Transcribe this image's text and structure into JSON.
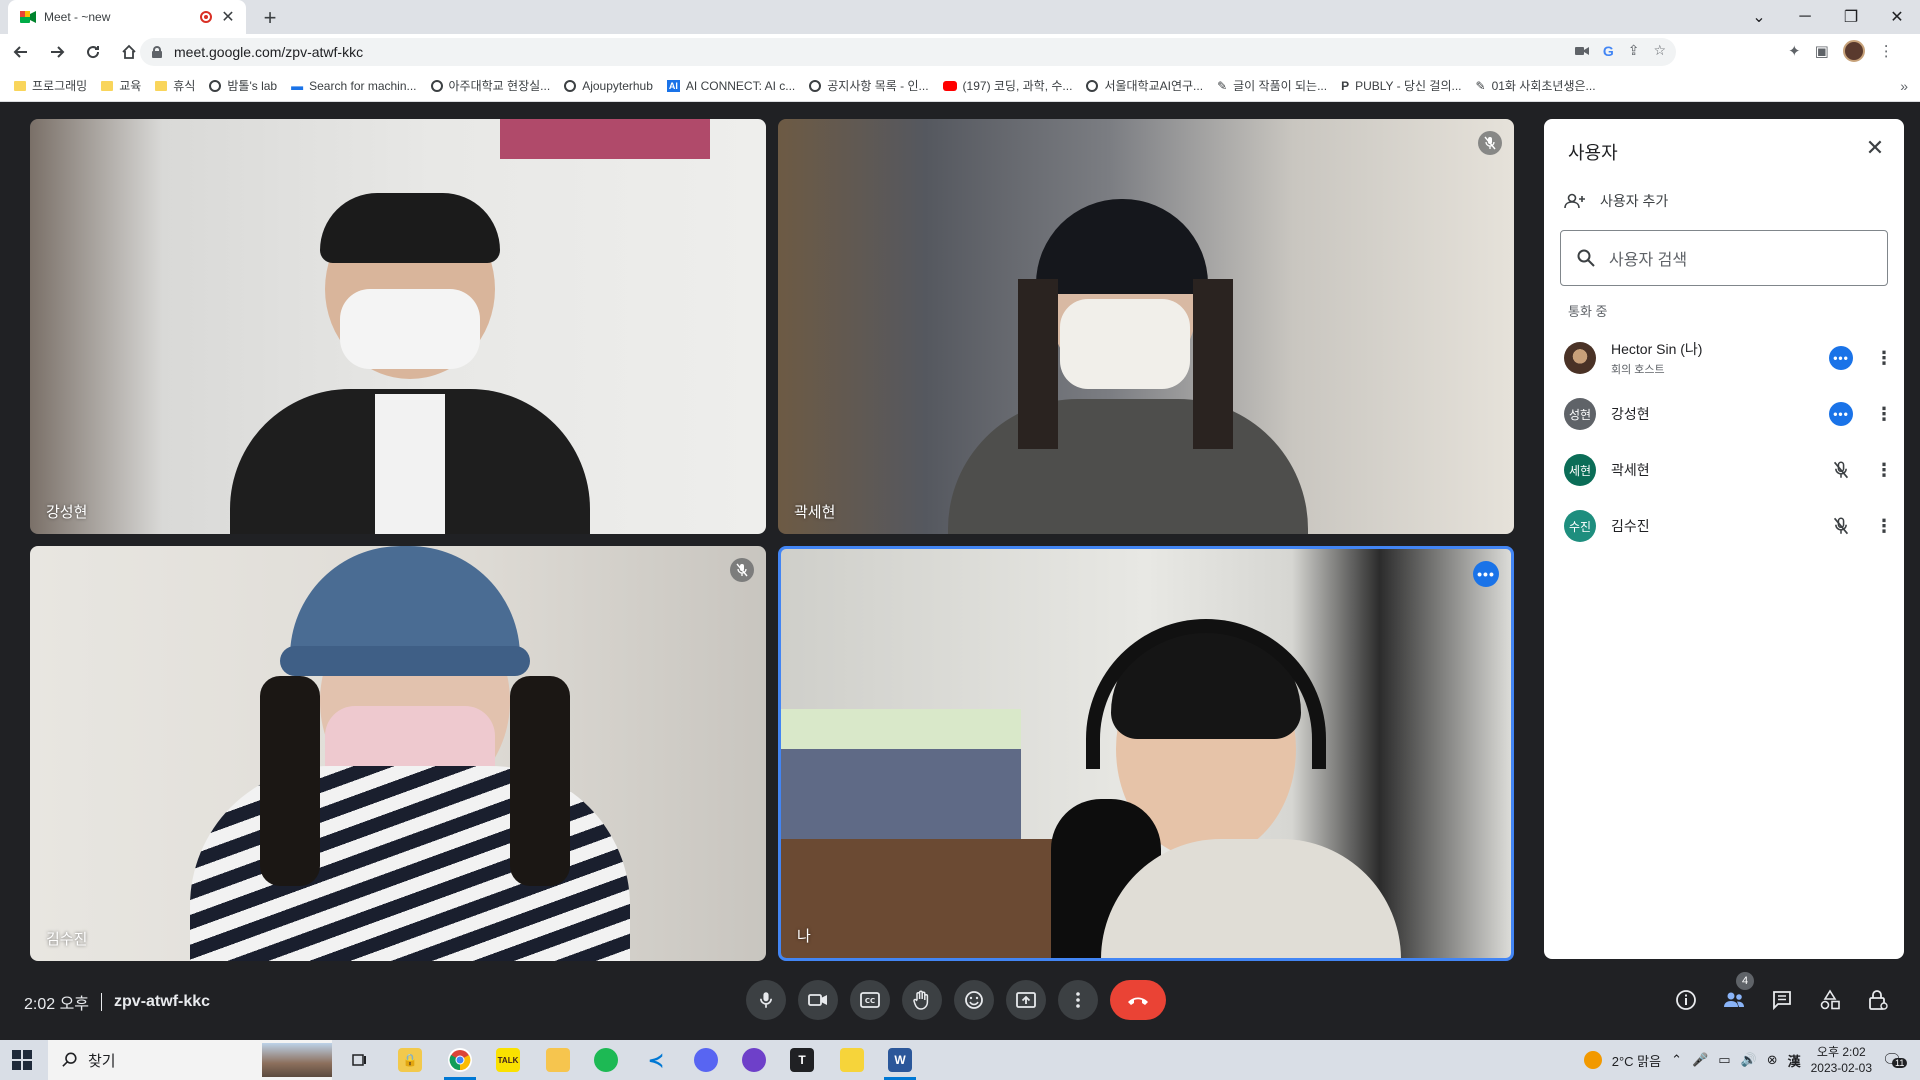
{
  "browser": {
    "tab_title": "Meet - ~new",
    "url": "meet.google.com/zpv-atwf-kkc",
    "bookmarks": [
      {
        "label": "프로그래밍",
        "icon": "folder-icon"
      },
      {
        "label": "교육",
        "icon": "folder-icon"
      },
      {
        "label": "휴식",
        "icon": "folder-icon"
      },
      {
        "label": "밤톨's lab",
        "icon": "globe-icon"
      },
      {
        "label": "Search for machin...",
        "icon": "bookmark-icon"
      },
      {
        "label": "아주대학교 현장실...",
        "icon": "globe-icon"
      },
      {
        "label": "Ajoupyterhub",
        "icon": "globe-icon"
      },
      {
        "label": "AI CONNECT: AI c...",
        "icon": "ai-icon"
      },
      {
        "label": "공지사항 목록 - 인...",
        "icon": "globe-icon"
      },
      {
        "label": "(197) 코딩, 과학, 수...",
        "icon": "youtube-icon"
      },
      {
        "label": "서울대학교AI연구...",
        "icon": "globe-icon"
      },
      {
        "label": "글이 작품이 되는...",
        "icon": "pen-icon"
      },
      {
        "label": "PUBLY - 당신 걸의...",
        "icon": "publy-icon"
      },
      {
        "label": "01화 사회초년생은...",
        "icon": "pen-icon"
      }
    ]
  },
  "tiles": [
    {
      "name": "강성현",
      "muted": false
    },
    {
      "name": "곽세현",
      "muted": true
    },
    {
      "name": "김수진",
      "muted": true
    },
    {
      "name": "나",
      "speaking": true
    }
  ],
  "panel": {
    "title": "사용자",
    "add_label": "사용자 추가",
    "search_placeholder": "사용자 검색",
    "section_label": "통화 중",
    "people": [
      {
        "name": "Hector Sin (나)",
        "sub": "회의 호스트",
        "avatar": "",
        "avatar_color": "#6b4a3a",
        "status": "speaking"
      },
      {
        "name": "강성현",
        "sub": "",
        "avatar": "성현",
        "avatar_color": "#5f6368",
        "status": "speaking"
      },
      {
        "name": "곽세현",
        "sub": "",
        "avatar": "세현",
        "avatar_color": "#0b6d57",
        "status": "muted"
      },
      {
        "name": "김수진",
        "sub": "",
        "avatar": "수진",
        "avatar_color": "#1e8e7e",
        "status": "muted"
      }
    ]
  },
  "bottom_bar": {
    "time": "2:02 오후",
    "meeting_code": "zpv-atwf-kkc",
    "participant_count": "4"
  },
  "taskbar": {
    "search_label": "찾기",
    "weather": "2°C  맑음",
    "time": "오후 2:02",
    "date": "2023-02-03",
    "notifications": "11"
  },
  "colors": {
    "meet_bg": "#202124",
    "end_call": "#ea4335",
    "active_speaker_border": "#4285f4",
    "speaking_badge": "#1a73e8"
  }
}
